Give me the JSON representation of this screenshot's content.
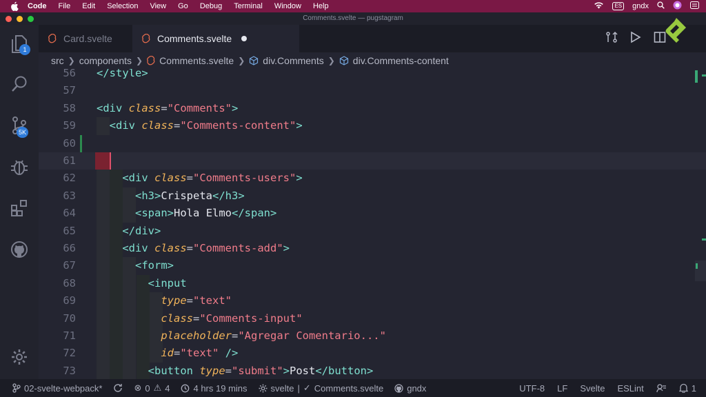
{
  "menubar": {
    "app": "Code",
    "items": [
      "File",
      "Edit",
      "Selection",
      "View",
      "Go",
      "Debug",
      "Terminal",
      "Window",
      "Help"
    ],
    "user": "gndx"
  },
  "window": {
    "title": "Comments.svelte — pugstagram"
  },
  "activity": {
    "explorer_badge": "1",
    "scm_badge": "5K"
  },
  "tabs": [
    {
      "label": "Card.svelte",
      "active": false
    },
    {
      "label": "Comments.svelte",
      "active": true,
      "modified": true
    }
  ],
  "breadcrumb": [
    "src",
    "components",
    "Comments.svelte",
    "div.Comments",
    "div.Comments-content"
  ],
  "editor": {
    "lines": [
      {
        "n": "56",
        "code": "</style>"
      },
      {
        "n": "57",
        "code": ""
      },
      {
        "n": "58",
        "code": "<div class=\"Comments\">"
      },
      {
        "n": "59",
        "code": "  <div class=\"Comments-content\">"
      },
      {
        "n": "60",
        "code": ""
      },
      {
        "n": "61",
        "code": ""
      },
      {
        "n": "62",
        "code": "    <div class=\"Comments-users\">"
      },
      {
        "n": "63",
        "code": "      <h3>Crispeta</h3>"
      },
      {
        "n": "64",
        "code": "      <span>Hola Elmo</span>"
      },
      {
        "n": "65",
        "code": "    </div>"
      },
      {
        "n": "66",
        "code": "    <div class=\"Comments-add\">"
      },
      {
        "n": "67",
        "code": "      <form>"
      },
      {
        "n": "68",
        "code": "        <input"
      },
      {
        "n": "69",
        "code": "          type=\"text\""
      },
      {
        "n": "70",
        "code": "          class=\"Comments-input\""
      },
      {
        "n": "71",
        "code": "          placeholder=\"Agregar Comentario...\""
      },
      {
        "n": "72",
        "code": "          id=\"text\" />"
      },
      {
        "n": "73",
        "code": "        <button type=\"submit\">Post</button>"
      }
    ]
  },
  "statusbar": {
    "branch": "02-svelte-webpack*",
    "errors": "0",
    "warnings": "4",
    "time": "4 hrs 19 mins",
    "language_ext": "svelte",
    "file": "Comments.svelte",
    "github_user": "gndx",
    "encoding": "UTF-8",
    "eol": "LF",
    "language": "Svelte",
    "linter": "ESLint",
    "notifications": "1"
  },
  "colors": {
    "menubar": "#7a1845",
    "accent_green": "#3aa876",
    "tag": "#7fe0d0",
    "attr": "#f0b35a",
    "string": "#f07c8a"
  }
}
